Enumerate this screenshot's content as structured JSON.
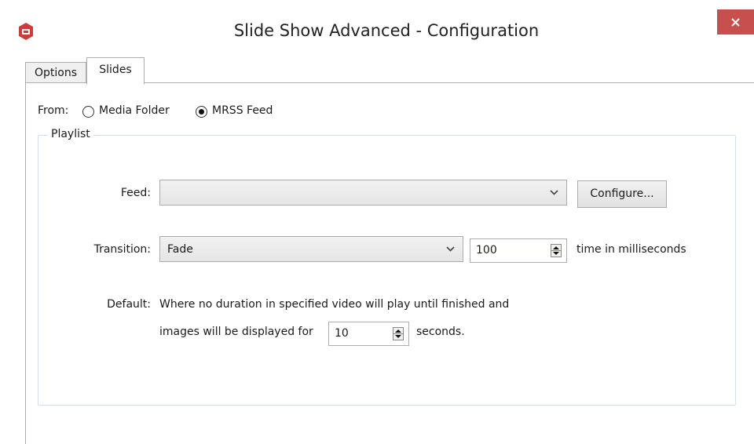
{
  "window": {
    "title": "Slide Show Advanced - Configuration",
    "app_icon": "xibo-red-icon",
    "close_icon": "close-icon",
    "accent_color": "#c7504f"
  },
  "tabs": [
    {
      "label": "Options",
      "selected": false
    },
    {
      "label": "Slides",
      "selected": true
    }
  ],
  "from": {
    "label": "From:",
    "options": [
      {
        "label": "Media Folder",
        "checked": false
      },
      {
        "label": "MRSS Feed",
        "checked": true
      }
    ]
  },
  "playlist": {
    "group_title": "Playlist",
    "feed": {
      "label": "Feed:",
      "value": "",
      "configure_label": "Configure..."
    },
    "transition": {
      "label": "Transition:",
      "value": "Fade",
      "duration": "100",
      "duration_suffix": "time in milliseconds"
    },
    "default": {
      "label": "Default:",
      "line1": "Where no duration in specified video will play until finished and",
      "line2_prefix": "images will be displayed for",
      "seconds_value": "10",
      "line2_suffix": "seconds."
    }
  }
}
